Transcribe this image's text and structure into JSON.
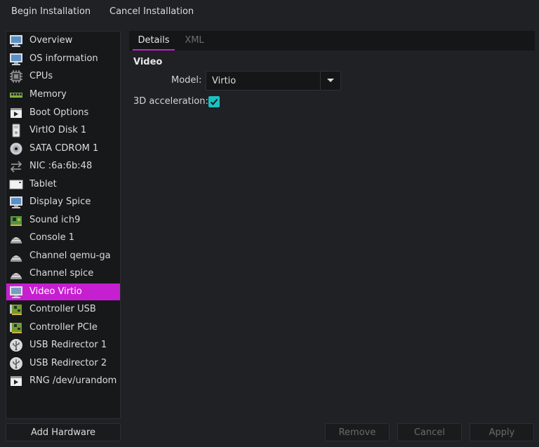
{
  "toolbar": {
    "begin_label": "Begin Installation",
    "cancel_label": "Cancel Installation"
  },
  "sidebar": {
    "items": [
      {
        "label": "Overview",
        "icon": "monitor-icon"
      },
      {
        "label": "OS information",
        "icon": "monitor-icon"
      },
      {
        "label": "CPUs",
        "icon": "cpu-chip-icon"
      },
      {
        "label": "Memory",
        "icon": "memory-module-icon"
      },
      {
        "label": "Boot Options",
        "icon": "boot-window-icon"
      },
      {
        "label": "VirtIO Disk 1",
        "icon": "disk-icon"
      },
      {
        "label": "SATA CDROM 1",
        "icon": "cdrom-icon"
      },
      {
        "label": "NIC :6a:6b:48",
        "icon": "network-arrows-icon"
      },
      {
        "label": "Tablet",
        "icon": "tablet-icon"
      },
      {
        "label": "Display Spice",
        "icon": "monitor-icon"
      },
      {
        "label": "Sound ich9",
        "icon": "sound-card-icon"
      },
      {
        "label": "Console 1",
        "icon": "serial-console-icon"
      },
      {
        "label": "Channel qemu-ga",
        "icon": "serial-console-icon"
      },
      {
        "label": "Channel spice",
        "icon": "serial-console-icon"
      },
      {
        "label": "Video Virtio",
        "icon": "video-monitor-icon",
        "selected": true
      },
      {
        "label": "Controller USB",
        "icon": "controller-card-icon"
      },
      {
        "label": "Controller PCIe",
        "icon": "controller-card-icon"
      },
      {
        "label": "USB Redirector 1",
        "icon": "usb-icon"
      },
      {
        "label": "USB Redirector 2",
        "icon": "usb-icon"
      },
      {
        "label": "RNG /dev/urandom",
        "icon": "rng-window-icon"
      }
    ],
    "add_hardware_label": "Add Hardware"
  },
  "tabs": [
    {
      "label": "Details",
      "active": true
    },
    {
      "label": "XML",
      "active": false
    }
  ],
  "details": {
    "section_title": "Video",
    "model_label": "Model:",
    "model_value": "Virtio",
    "accel_label": "3D acceleration:",
    "accel_checked": true
  },
  "footer": {
    "remove_label": "Remove",
    "cancel_label": "Cancel",
    "apply_label": "Apply"
  },
  "colors": {
    "accent": "#c61fd1",
    "checkbox": "#1ebfbf",
    "background": "#1f2124"
  }
}
